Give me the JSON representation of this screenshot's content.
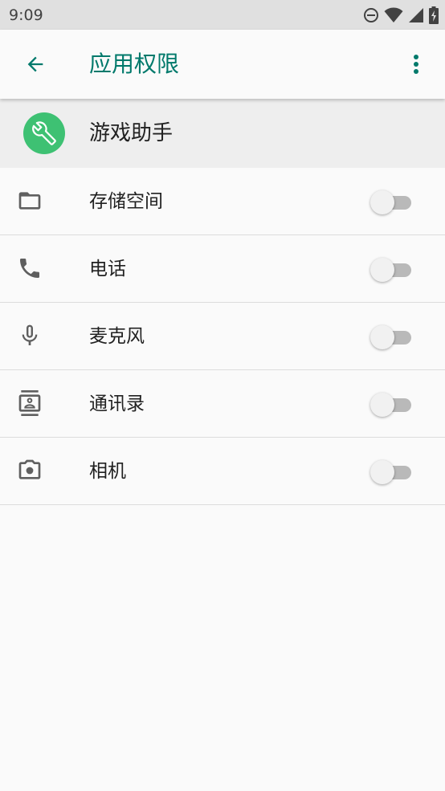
{
  "status_bar": {
    "time": "9:09",
    "icons": [
      "do-not-disturb-icon",
      "wifi-icon",
      "cellular-signal-icon",
      "battery-charging-icon"
    ]
  },
  "toolbar": {
    "title": "应用权限",
    "back_icon": "arrow-back-icon",
    "overflow_icon": "more-vert-icon"
  },
  "app": {
    "name": "游戏助手",
    "icon": "wrench-icon",
    "icon_color": "#3ec173"
  },
  "permissions": [
    {
      "label": "存储空间",
      "icon": "folder-icon",
      "enabled": false
    },
    {
      "label": "电话",
      "icon": "phone-icon",
      "enabled": false
    },
    {
      "label": "麦克风",
      "icon": "microphone-icon",
      "enabled": false
    },
    {
      "label": "通讯录",
      "icon": "contacts-icon",
      "enabled": false
    },
    {
      "label": "相机",
      "icon": "camera-icon",
      "enabled": false
    }
  ],
  "colors": {
    "accent": "#00796b",
    "toggle_track_off": "#b9b9b9",
    "toggle_thumb_off": "#f1f1f1"
  }
}
